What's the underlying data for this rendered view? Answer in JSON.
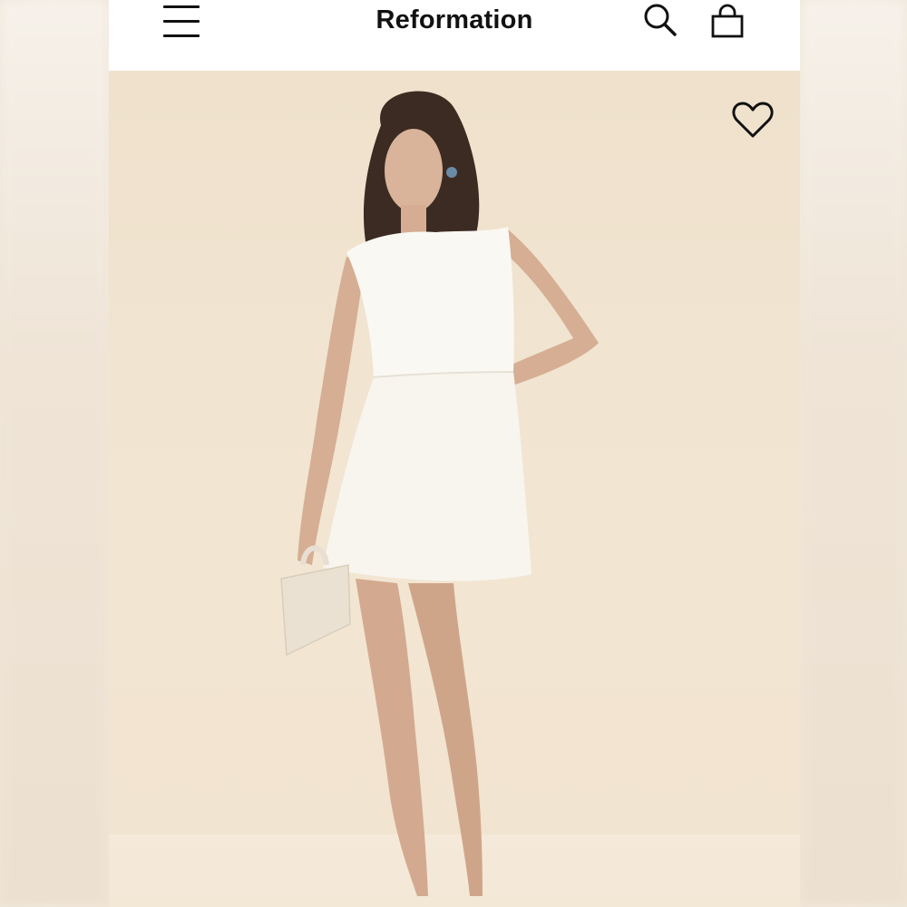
{
  "header": {
    "brand": "Reformation",
    "icons": {
      "menu": "hamburger-menu-icon",
      "search": "search-icon",
      "bag": "shopping-bag-icon"
    }
  },
  "product_image": {
    "favorite_icon": "heart-icon"
  },
  "colors": {
    "header_bg": "#ffffff",
    "icon_color": "#111111",
    "backdrop": "#f2e6d4"
  }
}
